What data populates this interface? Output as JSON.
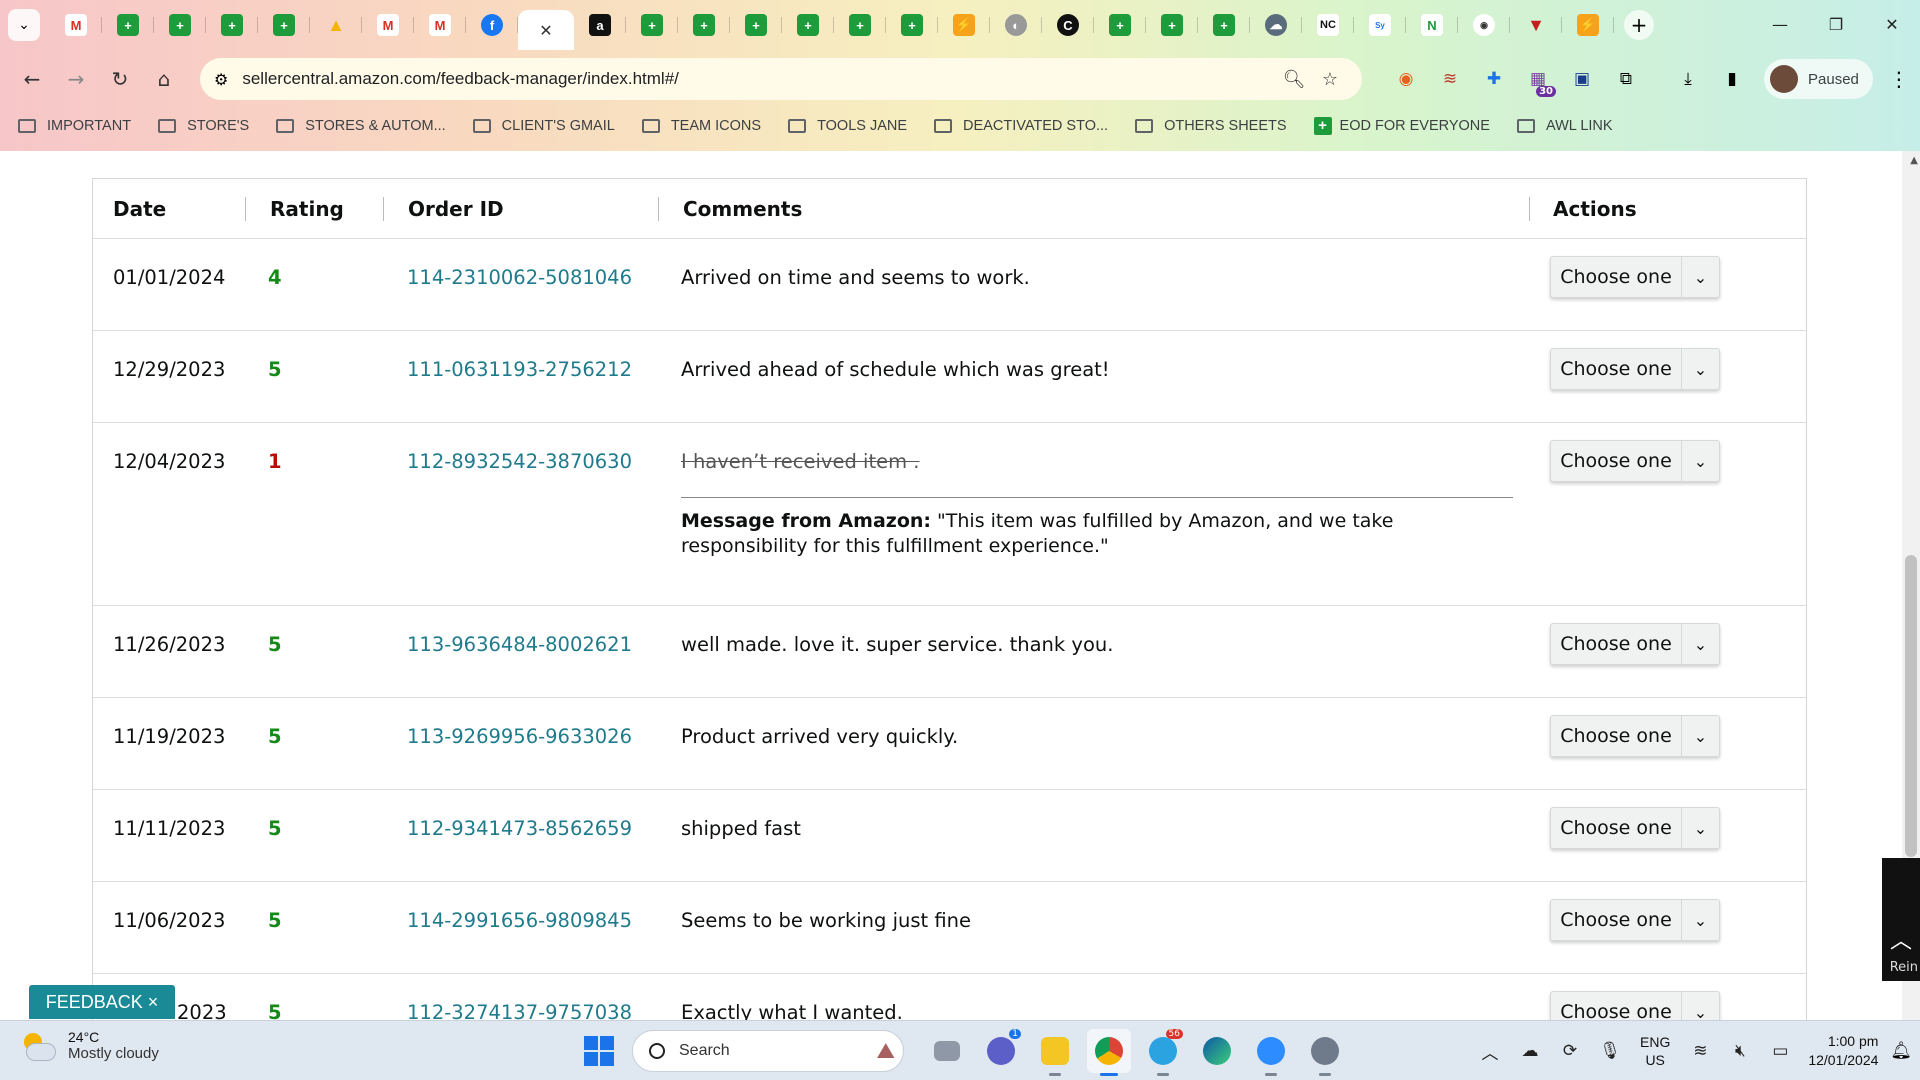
{
  "browser": {
    "url": "sellercentral.amazon.com/feedback-manager/index.html#/",
    "profile_label": "Paused",
    "ext_badge": "30",
    "bookmarks": [
      {
        "label": "IMPORTANT",
        "kind": "folder"
      },
      {
        "label": "STORE'S",
        "kind": "folder"
      },
      {
        "label": "STORES & AUTOM...",
        "kind": "folder"
      },
      {
        "label": "CLIENT'S GMAIL",
        "kind": "folder"
      },
      {
        "label": "TEAM ICONS",
        "kind": "folder"
      },
      {
        "label": "TOOLS JANE",
        "kind": "folder"
      },
      {
        "label": "DEACTIVATED STO...",
        "kind": "folder"
      },
      {
        "label": "OTHERS SHEETS",
        "kind": "folder"
      },
      {
        "label": "EOD FOR EVERYONE",
        "kind": "sheet"
      },
      {
        "label": "AWL LINK",
        "kind": "folder"
      }
    ]
  },
  "table": {
    "headers": {
      "date": "Date",
      "rating": "Rating",
      "order_id": "Order ID",
      "comments": "Comments",
      "actions": "Actions"
    },
    "action_label": "Choose one",
    "rows": [
      {
        "date": "01/01/2024",
        "rating": "4",
        "order_id": "114-2310062-5081046",
        "comment": "Arrived on time and seems to work."
      },
      {
        "date": "12/29/2023",
        "rating": "5",
        "order_id": "111-0631193-2756212",
        "comment": "Arrived ahead of schedule which was great!"
      },
      {
        "date": "12/04/2023",
        "rating": "1",
        "order_id": "112-8932542-3870630",
        "comment": "I haven’t received item .",
        "struck": true,
        "message_label": "Message from Amazon:",
        "message_text": " \"This item was fulfilled by Amazon, and we take responsibility for this fulfillment experience.\""
      },
      {
        "date": "11/26/2023",
        "rating": "5",
        "order_id": "113-9636484-8002621",
        "comment": "well made. love it. super service. thank you."
      },
      {
        "date": "11/19/2023",
        "rating": "5",
        "order_id": "113-9269956-9633026",
        "comment": "Product arrived very quickly."
      },
      {
        "date": "11/11/2023",
        "rating": "5",
        "order_id": "112-9341473-8562659",
        "comment": "shipped fast"
      },
      {
        "date": "11/06/2023",
        "rating": "5",
        "order_id": "114-2991656-9809845",
        "comment": "Seems to be working just fine"
      },
      {
        "date": "2023",
        "rating": "5",
        "order_id": "112-3274137-9757038",
        "comment": "Exactly what I wanted."
      }
    ]
  },
  "feedback_button": "FEEDBACK ×",
  "side_widget_label": "Rein",
  "taskbar": {
    "weather_temp": "24°C",
    "weather_desc": "Mostly cloudy",
    "search_label": "Search",
    "teams_badge": "1",
    "telegram_badge": "56",
    "lang_1": "ENG",
    "lang_2": "US",
    "time": "1:00 pm",
    "date": "12/01/2024"
  },
  "colors": {
    "link": "#1f7a8c",
    "rating_good": "#168a18",
    "rating_bad": "#b80c09",
    "feedback_bg": "#1a8a96"
  }
}
